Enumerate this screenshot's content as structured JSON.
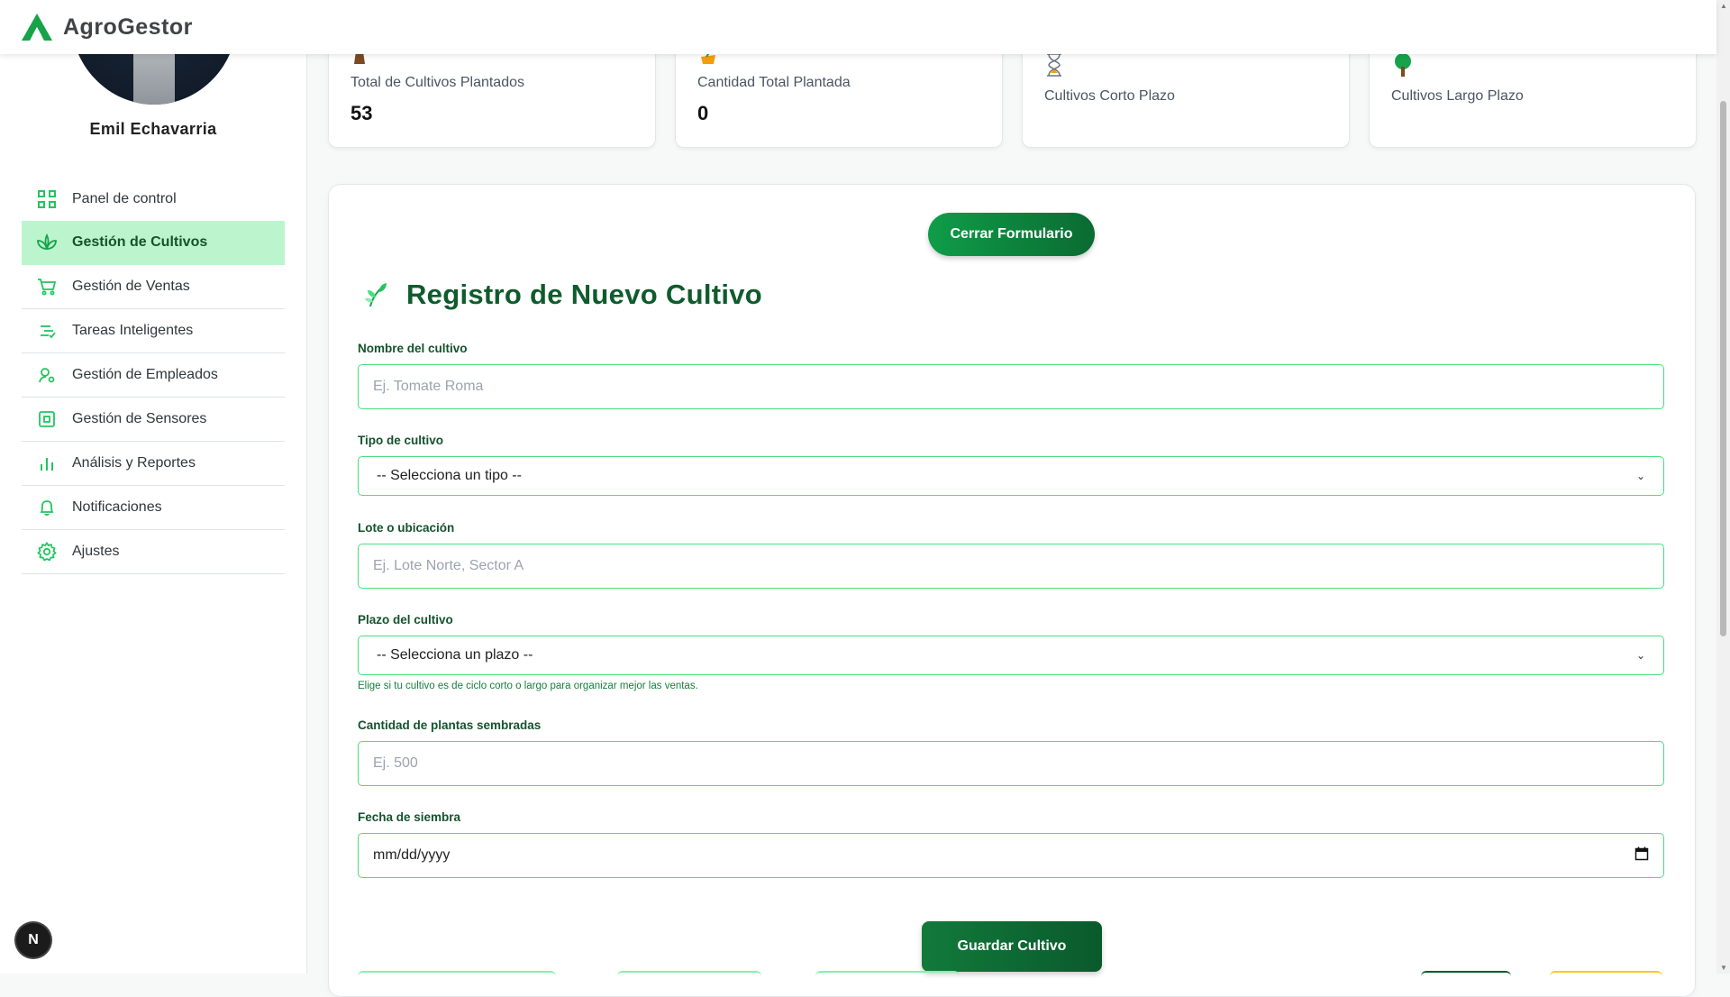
{
  "app": {
    "title": "AgroGestor"
  },
  "user": {
    "name": "Emil Echavarria"
  },
  "sidebar": {
    "items": [
      {
        "label": "Panel de control",
        "icon": "grid-icon"
      },
      {
        "label": "Gestión de Cultivos",
        "icon": "plant-icon",
        "active": true
      },
      {
        "label": "Gestión de Ventas",
        "icon": "cart-icon"
      },
      {
        "label": "Tareas Inteligentes",
        "icon": "checklist-icon"
      },
      {
        "label": "Gestión de Empleados",
        "icon": "employees-icon"
      },
      {
        "label": "Gestión de Sensores",
        "icon": "sensor-icon"
      },
      {
        "label": "Análisis y Reportes",
        "icon": "bar-chart-icon"
      },
      {
        "label": "Notificaciones",
        "icon": "bell-icon"
      },
      {
        "label": "Ajustes",
        "icon": "gear-icon"
      }
    ]
  },
  "stats": [
    {
      "label": "Total de Cultivos Plantados",
      "value": "53",
      "icon": "shovel-icon"
    },
    {
      "label": "Cantidad Total Plantada",
      "value": "0",
      "icon": "seedling-pot-icon"
    },
    {
      "label": "Cultivos Corto Plazo",
      "value": "",
      "icon": "hourglass-icon"
    },
    {
      "label": "Cultivos Largo Plazo",
      "value": "",
      "icon": "tree-icon"
    }
  ],
  "form": {
    "close_button": "Cerrar Formulario",
    "title": "Registro de Nuevo Cultivo",
    "title_icon": "herb-icon",
    "fields": {
      "name": {
        "label": "Nombre del cultivo",
        "placeholder": "Ej. Tomate Roma"
      },
      "type": {
        "label": "Tipo de cultivo",
        "selected": "-- Selecciona un tipo --"
      },
      "location": {
        "label": "Lote o ubicación",
        "placeholder": "Ej. Lote Norte, Sector A"
      },
      "term": {
        "label": "Plazo del cultivo",
        "selected": "-- Selecciona un plazo --",
        "hint": "Elige si tu cultivo es de ciclo corto o largo para organizar mejor las ventas."
      },
      "quantity": {
        "label": "Cantidad de plantas sembradas",
        "placeholder": "Ej. 500"
      },
      "date": {
        "label": "Fecha de siembra",
        "value": "mm/dd/yyyy"
      }
    },
    "save_button": "Guardar Cultivo"
  },
  "badge": {
    "letter": "N"
  },
  "colors": {
    "brand_green": "#0f9d48",
    "active_nav": "#bcf5cd",
    "input_border": "#4ade80",
    "title_green": "#0f5b2d"
  }
}
